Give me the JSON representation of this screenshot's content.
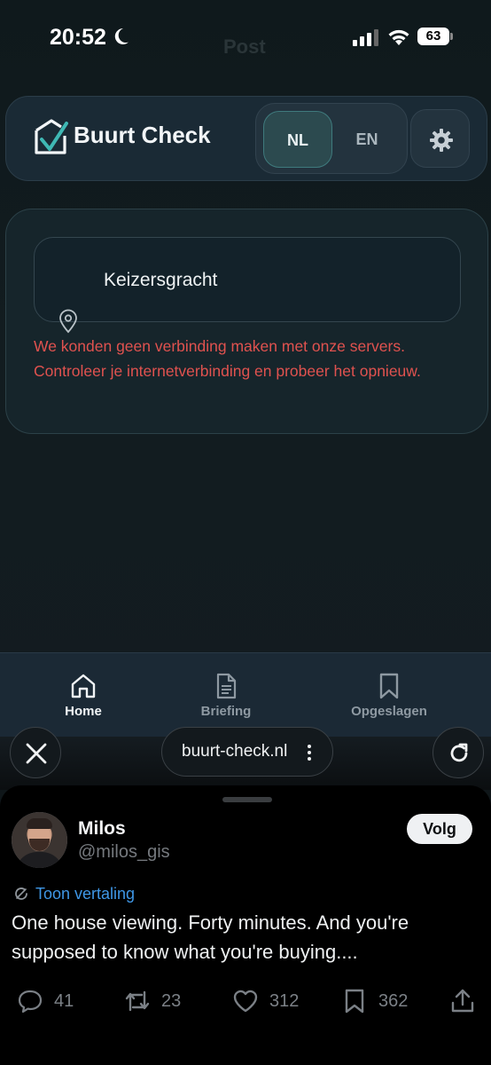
{
  "status_bar": {
    "time": "20:52",
    "battery": "63",
    "faded_title": "Post"
  },
  "app": {
    "title": "Buurt Check",
    "lang_nl": "NL",
    "lang_en": "EN",
    "active_language": "NL",
    "accent_color": "#3f7a7d"
  },
  "search": {
    "value": "Keizersgracht",
    "error": "We konden geen verbinding maken met onze servers. Controleer je internetverbinding en probeer het opnieuw.",
    "error_color": "#e0524f"
  },
  "nav": {
    "items": [
      {
        "label": "Home",
        "icon": "home-icon",
        "active": true
      },
      {
        "label": "Briefing",
        "icon": "document-icon",
        "active": false
      },
      {
        "label": "Opgeslagen",
        "icon": "bookmark-icon",
        "active": false
      }
    ]
  },
  "browser": {
    "url": "buurt-check.nl"
  },
  "tweet": {
    "name": "Milos",
    "handle": "@milos_gis",
    "follow_label": "Volg",
    "translate_label": "Toon vertaling",
    "text": "One house viewing. Forty minutes. And you're supposed to know what you're buying....",
    "replies": "41",
    "retweets": "23",
    "likes": "312",
    "bookmarks": "362",
    "link_color": "#3f97e6"
  }
}
